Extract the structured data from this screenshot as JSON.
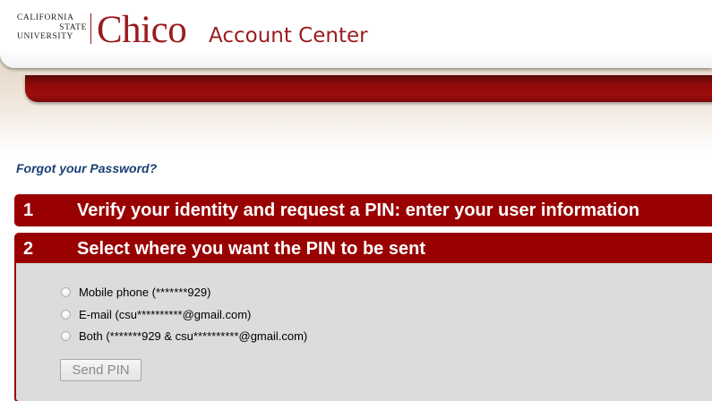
{
  "header": {
    "logo_line1": "CALIFORNIA",
    "logo_line2": "STATE",
    "logo_line3": "UNIVERSITY",
    "logo_name": "Chico",
    "app_title": "Account Center"
  },
  "page": {
    "heading": "Forgot your Password?"
  },
  "steps": [
    {
      "number": "1",
      "title": "Verify your identity and request a PIN: enter your user information"
    },
    {
      "number": "2",
      "title": "Select where you want the PIN to be sent"
    }
  ],
  "pin_options": [
    {
      "label": "Mobile phone (*******929)"
    },
    {
      "label": "E-mail (csu**********@gmail.com)"
    },
    {
      "label": "Both (*******929 & csu**********@gmail.com)"
    }
  ],
  "send_button": "Send PIN",
  "colors": {
    "brand_red": "#990000",
    "logo_red": "#9b1b1e",
    "heading_blue": "#1a3e73",
    "panel_gray": "#dcdcdc"
  }
}
